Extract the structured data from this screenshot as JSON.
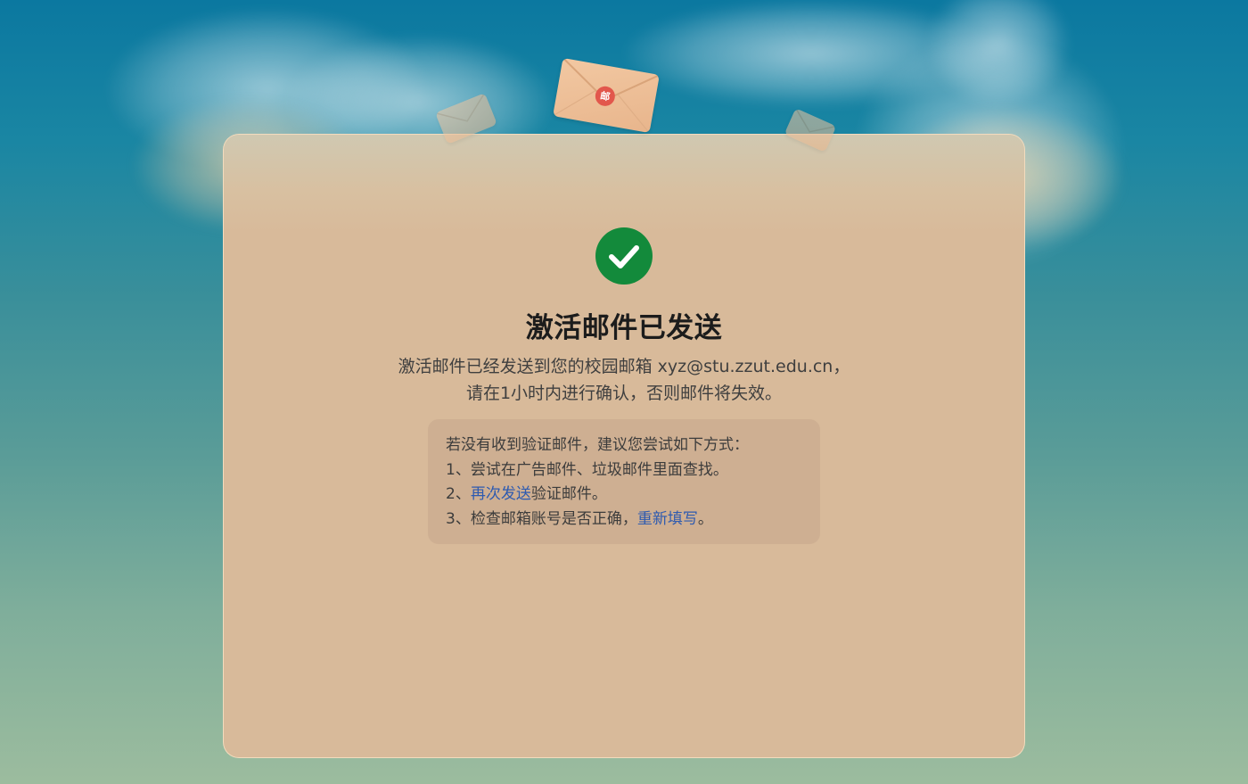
{
  "status": {
    "icon": "check-circle-icon",
    "title": "激活邮件已发送"
  },
  "message": {
    "line1_prefix": "激活邮件已经发送到您的校园邮箱 ",
    "email": "xyz@stu.zzut.edu.cn",
    "line1_suffix": "，",
    "line2": "请在1小时内进行确认，否则邮件将失效。"
  },
  "tips": {
    "heading": "若没有收到验证邮件，建议您尝试如下方式：",
    "item1": "1、尝试在广告邮件、垃圾邮件里面查找。",
    "item2_prefix": "2、",
    "item2_link": "再次发送",
    "item2_suffix": "验证邮件。",
    "item3_prefix": "3、检查邮箱账号是否正确，",
    "item3_link": "重新填写",
    "item3_suffix": "。"
  },
  "decor": {
    "envelope_seal": "邮",
    "envelope_icon": "envelope-icon"
  },
  "colors": {
    "success": "#138a3b",
    "card": "#d8ba9a",
    "link": "#2d5ab0",
    "seal": "#e2574c"
  }
}
